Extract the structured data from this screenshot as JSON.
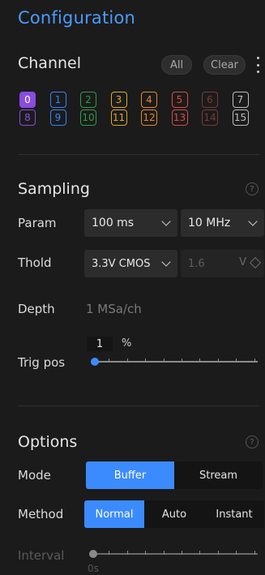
{
  "title": "Configuration",
  "channel": {
    "label": "Channel",
    "all_label": "All",
    "clear_label": "Clear",
    "chips": [
      {
        "n": "0",
        "color": "#8a4be0",
        "selected": true
      },
      {
        "n": "1",
        "color": "#3b82f6",
        "selected": false
      },
      {
        "n": "2",
        "color": "#2e9b4a",
        "selected": false
      },
      {
        "n": "3",
        "color": "#d9a92a",
        "selected": false
      },
      {
        "n": "4",
        "color": "#e08a2a",
        "selected": false
      },
      {
        "n": "5",
        "color": "#d94a4a",
        "selected": false
      },
      {
        "n": "6",
        "color": "#7a3a3a",
        "selected": false
      },
      {
        "n": "7",
        "color": "#bdbdbd",
        "selected": false
      },
      {
        "n": "8",
        "color": "#8a4be0",
        "selected": false
      },
      {
        "n": "9",
        "color": "#3b82f6",
        "selected": false
      },
      {
        "n": "10",
        "color": "#2e9b4a",
        "selected": false
      },
      {
        "n": "11",
        "color": "#d9a92a",
        "selected": false
      },
      {
        "n": "12",
        "color": "#e08a2a",
        "selected": false
      },
      {
        "n": "13",
        "color": "#d94a4a",
        "selected": false
      },
      {
        "n": "14",
        "color": "#7a3a3a",
        "selected": false
      },
      {
        "n": "15",
        "color": "#bdbdbd",
        "selected": false
      }
    ]
  },
  "sampling": {
    "label": "Sampling",
    "param_label": "Param",
    "duration_value": "100 ms",
    "rate_value": "10 MHz",
    "thold_label": "Thold",
    "thold_value": "3.3V CMOS",
    "thold_number": "1.6",
    "thold_unit": "V",
    "depth_label": "Depth",
    "depth_value": "1 MSa/ch",
    "trig_label": "Trig pos",
    "trig_value": "1",
    "trig_unit": "%",
    "trig_fraction": 0.01
  },
  "options": {
    "label": "Options",
    "mode_label": "Mode",
    "mode_options": [
      "Buffer",
      "Stream"
    ],
    "mode_selected": "Buffer",
    "method_label": "Method",
    "method_options": [
      "Normal",
      "Auto",
      "Instant"
    ],
    "method_selected": "Normal",
    "interval_label": "Interval",
    "interval_tick": "0s"
  },
  "colors": {
    "accent": "#3b8bff",
    "title": "#4b9bff"
  }
}
